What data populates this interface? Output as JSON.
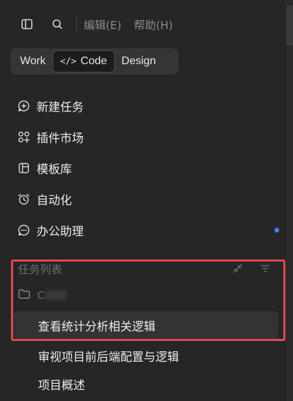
{
  "topbar": {
    "menus": [
      "编辑(E)",
      "帮助(H)"
    ]
  },
  "modes": {
    "tabs": [
      {
        "label": "Work"
      },
      {
        "label": "Code",
        "glyph": "</>"
      },
      {
        "label": "Design"
      }
    ],
    "active": "Code"
  },
  "nav": {
    "items": [
      {
        "label": "新建任务",
        "icon": "plus-chat-icon"
      },
      {
        "label": "插件市场",
        "icon": "plugin-grid-icon"
      },
      {
        "label": "模板库",
        "icon": "template-icon"
      },
      {
        "label": "自动化",
        "icon": "alarm-clock-icon"
      },
      {
        "label": "办公助理",
        "icon": "chat-bubble-icon",
        "badge_color": "#3b82f6"
      }
    ]
  },
  "tasks": {
    "title": "任务列表",
    "folder_name": "C",
    "items": [
      {
        "label": "查看统计分析相关逻辑",
        "selected": true
      },
      {
        "label": "审视项目前后端配置与逻辑",
        "selected": false
      },
      {
        "label": "项目概述",
        "selected": false
      }
    ]
  },
  "colors": {
    "background": "#262626",
    "highlight_border": "#e8474b",
    "badge": "#3b82f6"
  }
}
